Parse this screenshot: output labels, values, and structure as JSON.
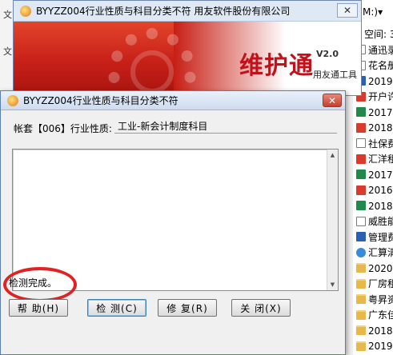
{
  "background": {
    "left_glyphs": [
      "文",
      "文"
    ],
    "address_fragment": "M:)▾",
    "space_fragment": "空间: 3",
    "items": [
      {
        "icon": "doc",
        "label": "通迅录"
      },
      {
        "icon": "doc",
        "label": "花名册"
      },
      {
        "icon": "word",
        "label": "2019年"
      },
      {
        "icon": "pdf",
        "label": "开户许"
      },
      {
        "icon": "excel",
        "label": "2017年"
      },
      {
        "icon": "pdf",
        "label": "2018年"
      },
      {
        "icon": "doc",
        "label": "社保费"
      },
      {
        "icon": "pdf",
        "label": "汇洋租"
      },
      {
        "icon": "excel",
        "label": "2017年"
      },
      {
        "icon": "pdf",
        "label": "2016年"
      },
      {
        "icon": "excel",
        "label": "2018年"
      },
      {
        "icon": "doc",
        "label": "威胜能"
      },
      {
        "icon": "word",
        "label": "管理费"
      },
      {
        "icon": "app",
        "label": "汇算清"
      },
      {
        "icon": "folder",
        "label": "2020年"
      },
      {
        "icon": "folder",
        "label": "厂房租"
      },
      {
        "icon": "folder",
        "label": "粤昇资"
      },
      {
        "icon": "folder",
        "label": "广东佳"
      },
      {
        "icon": "folder",
        "label": "2018年"
      },
      {
        "icon": "folder",
        "label": "2019年"
      }
    ]
  },
  "back_window": {
    "title": "BYYZZ004行业性质与科目分类不符   用友软件股份有限公司",
    "close_glyph": "✕",
    "brand_name": "维护通",
    "brand_version": "V2.0",
    "brand_sub": "用友通工具"
  },
  "dialog": {
    "title": "BYYZZ004行业性质与科目分类不符",
    "close_glyph": "✕",
    "account_label": "帐套【006】行业性质:",
    "account_value": "工业-新会计制度科目",
    "list_items": [],
    "status_text": "检测完成。",
    "buttons": {
      "help": "帮 助(H)",
      "check": "检 测(C)",
      "repair": "修 复(R)",
      "close": "关 闭(X)"
    }
  },
  "colors": {
    "annotation_circle": "#e22222",
    "banner_red": "#c72018",
    "brand_text": "#c1121b"
  }
}
